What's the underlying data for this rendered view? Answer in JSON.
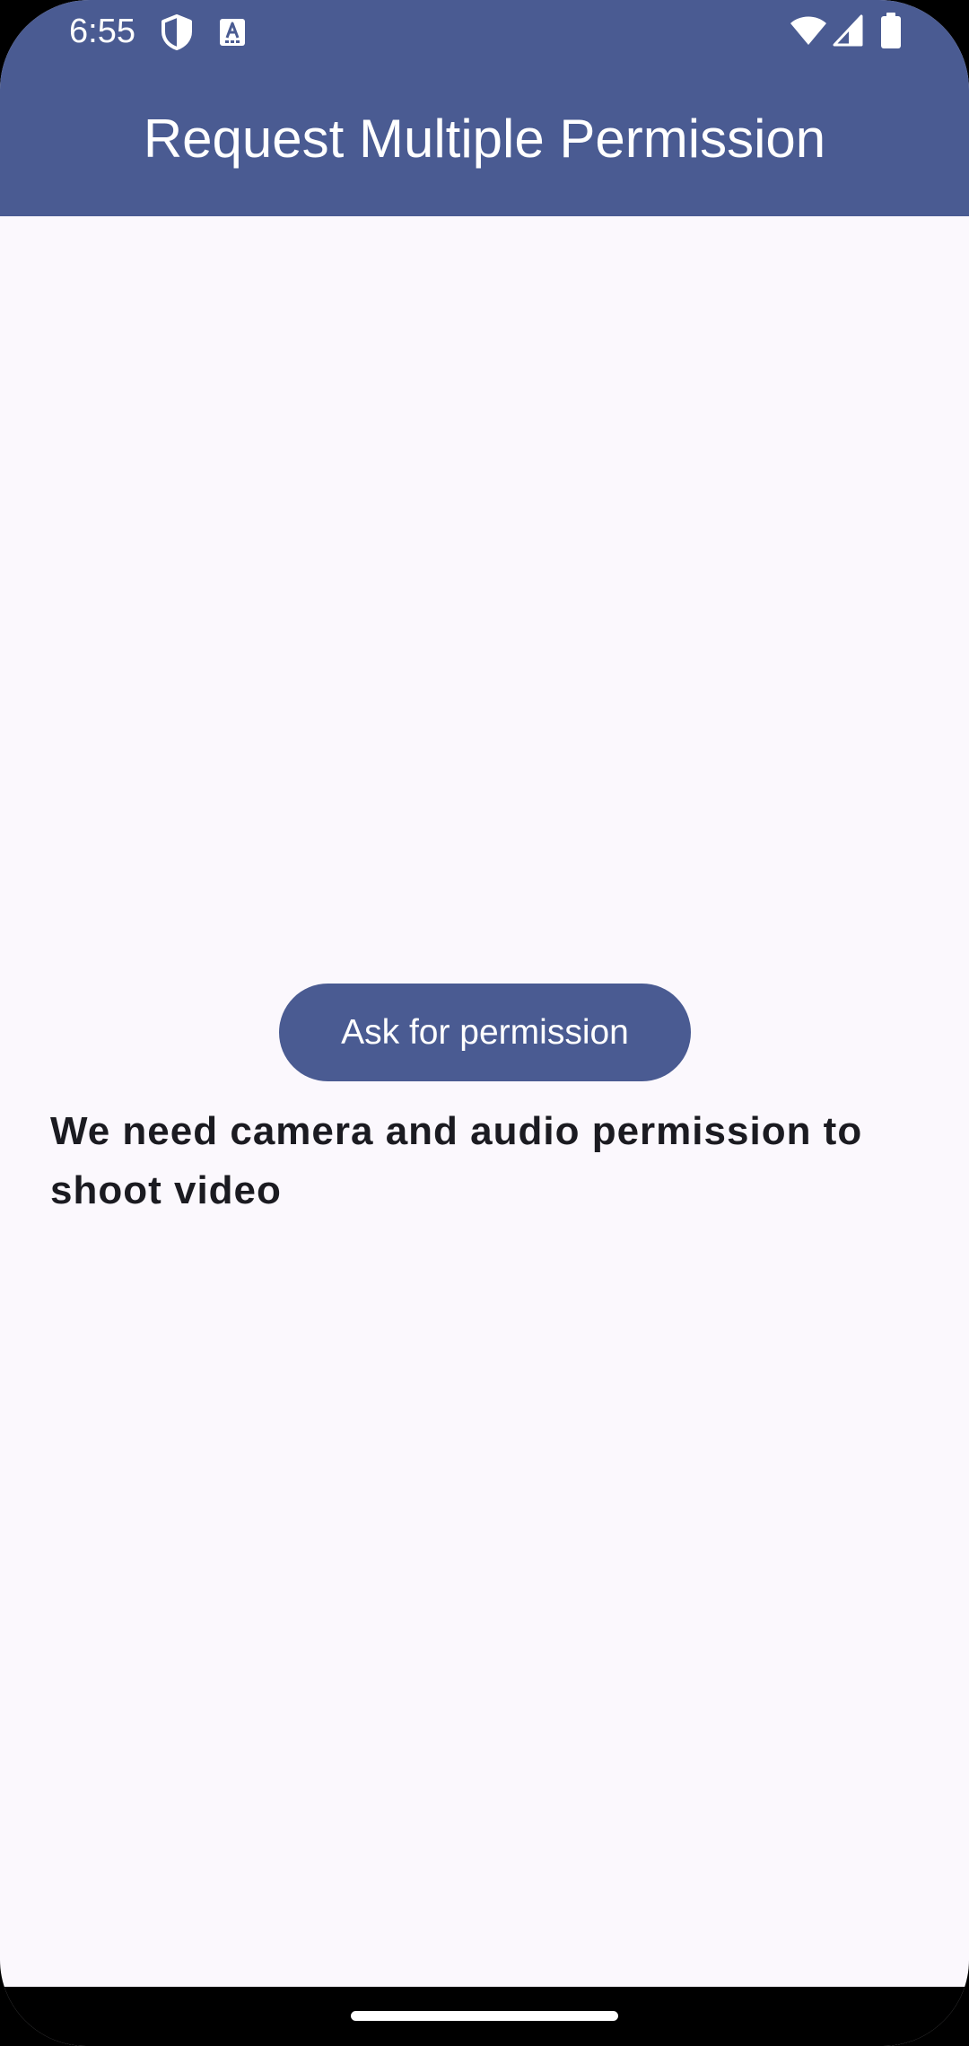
{
  "status_bar": {
    "time": "6:55",
    "left_icons": [
      "shield-icon",
      "font-a-icon"
    ],
    "right_icons": [
      "wifi-icon",
      "cellular-signal-icon",
      "battery-icon"
    ]
  },
  "app_bar": {
    "title": "Request Multiple Permission",
    "background_color": "#4a5b92",
    "title_color": "#ffffff"
  },
  "main": {
    "button_label": "Ask for permission",
    "message": "We need camera and audio permission to shoot video",
    "background_color": "#fbf8fd"
  },
  "navigation": {
    "home_indicator": "gesture-bar"
  }
}
